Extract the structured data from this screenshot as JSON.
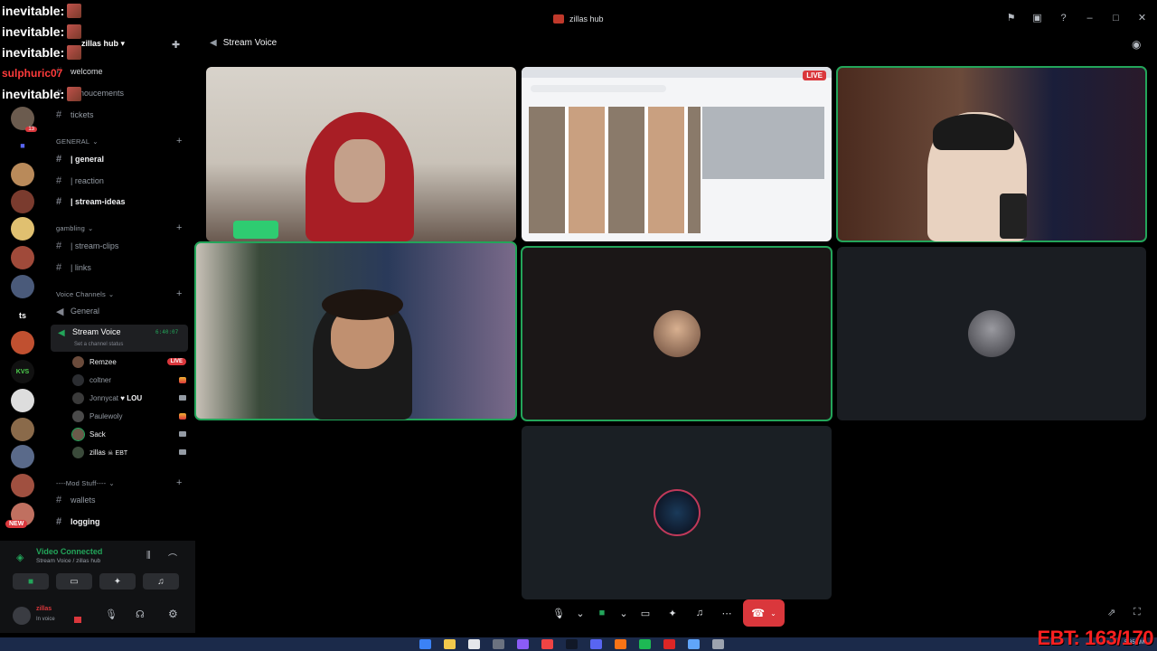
{
  "window": {
    "title": "zillas hub"
  },
  "overlay": {
    "lines": [
      "inevitable:",
      "inevitable:",
      "inevitable:",
      "sulphuric07",
      "inevitable:"
    ]
  },
  "sidebar": {
    "server_name": "zillas hub",
    "top_channels": [
      {
        "label": "welcome"
      },
      {
        "label": "annoucements"
      },
      {
        "label": "tickets"
      }
    ],
    "categories": {
      "general": "GENERAL",
      "gambling": "gambling",
      "voice": "Voice Channels",
      "mod": "----Mod Stuff----"
    },
    "general_channels": [
      {
        "label": "| general"
      },
      {
        "label": "| reaction"
      },
      {
        "label": "| stream-ideas"
      }
    ],
    "gambling_channels": [
      {
        "label": "| stream-clips"
      },
      {
        "label": "| links"
      }
    ],
    "voice_channels": {
      "general": "General",
      "active": "Stream Voice",
      "status_placeholder": "Set a channel status",
      "timer": "6:40:07"
    },
    "members": [
      {
        "name": "Remzee",
        "badge": "LIVE"
      },
      {
        "name": "coltner",
        "badge": ""
      },
      {
        "name": "Jonnycat",
        "badge": "LOU"
      },
      {
        "name": "Paulewoly",
        "badge": ""
      },
      {
        "name": "Sack",
        "badge": ""
      },
      {
        "name": "zillas",
        "badge": "EBT"
      }
    ],
    "mod_channels": [
      {
        "label": "wallets"
      },
      {
        "label": "logging"
      }
    ],
    "rail_badges": {
      "first": "13",
      "new": "NEW"
    },
    "rail_labels": {
      "ts": "ts",
      "kvs": "KVS"
    }
  },
  "voice_panel": {
    "status": "Video Connected",
    "location": "Stream Voice / zillas hub"
  },
  "user_panel": {
    "name": "zillas",
    "status": "In voice"
  },
  "stage": {
    "title": "Stream Voice",
    "live_label": "LIVE"
  },
  "overlay_counter": "EBT: 163/170",
  "taskbar": {
    "time": "5:35 AM"
  },
  "icons": {
    "voice": "speaker-icon",
    "hangup": "phone-hangup-icon",
    "mic": "microphone-icon",
    "camera": "camera-icon",
    "screen_share": "screen-share-icon",
    "activities": "activities-icon",
    "soundboard": "soundboard-icon",
    "more": "more-icon",
    "settings": "gear-icon",
    "headphones": "headphones-icon"
  },
  "colors": {
    "accent_green": "#23a55a",
    "danger_red": "#da373c",
    "counter_red": "#ff2020"
  }
}
